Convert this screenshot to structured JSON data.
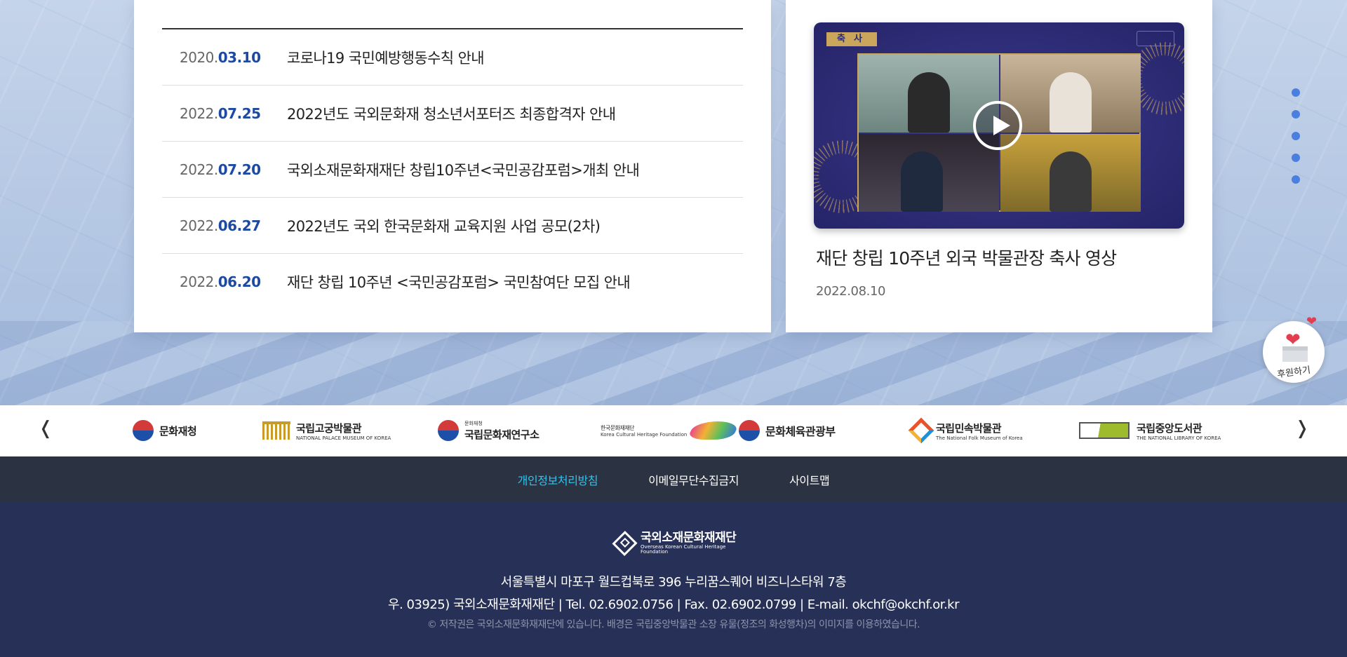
{
  "notices": [
    {
      "year": "2020.",
      "md": "03.10",
      "title": "코로나19 국민예방행동수칙 안내"
    },
    {
      "year": "2022.",
      "md": "07.25",
      "title": "2022년도 국외문화재 청소년서포터즈 최종합격자 안내"
    },
    {
      "year": "2022.",
      "md": "07.20",
      "title": "국외소재문화재재단 창립10주년<국민공감포럼>개최 안내"
    },
    {
      "year": "2022.",
      "md": "06.27",
      "title": "2022년도 국외 한국문화재 교육지원 사업 공모(2차)"
    },
    {
      "year": "2022.",
      "md": "06.20",
      "title": "재단 창립 10주년 <국민공감포럼> 국민참여단 모집 안내"
    }
  ],
  "video": {
    "badge": "축사",
    "title": "재단 창립 10주년 외국 박물관장 축사 영상",
    "date": "2022.08.10"
  },
  "support": {
    "label": "후원하기"
  },
  "partners": {
    "prev": "❬",
    "next": "❭",
    "logos": [
      {
        "name": "문화재청"
      },
      {
        "name": "국립고궁박물관",
        "sub": "NATIONAL PALACE MUSEUM OF KOREA"
      },
      {
        "name": "국립문화재연구소",
        "sub": "문화재청"
      },
      {
        "name": "한국문화재재단",
        "sub": "Korea Cultural Heritage Foundation"
      },
      {
        "name": "문화체육관광부"
      },
      {
        "name": "국립민속박물관",
        "sub": "The National Folk Museum of Korea"
      },
      {
        "name": "국립중앙도서관",
        "sub": "THE NATIONAL LIBRARY OF KOREA"
      }
    ]
  },
  "footer_nav": {
    "privacy": "개인정보처리방침",
    "email_policy": "이메일무단수집금지",
    "sitemap": "사이트맵"
  },
  "footer": {
    "org_name": "국외소재문화재재단",
    "org_name_en": "Overseas Korean Cultural Heritage Foundation",
    "address": "서울특별시 마포구 월드컵북로 396 누리꿈스퀘어 비즈니스타워 7층",
    "contact": "우. 03925) 국외소재문화재재단 | Tel. 02.6902.0756 | Fax. 02.6902.0799 | E-mail. okchf@okchf.or.kr",
    "copyright": "© 저작권은 국외소재문화재재단에 있습니다. 배경은 국립중앙박물관 소장 유물(정조의 화성행차)의 이미지를 이용하였습니다."
  },
  "colors": {
    "accent": "#1d4aa0",
    "footer_nav_bg": "#2b3343",
    "footer_bg": "#273056",
    "active_link": "#28c6f0",
    "dot": "#4a7fe0"
  }
}
